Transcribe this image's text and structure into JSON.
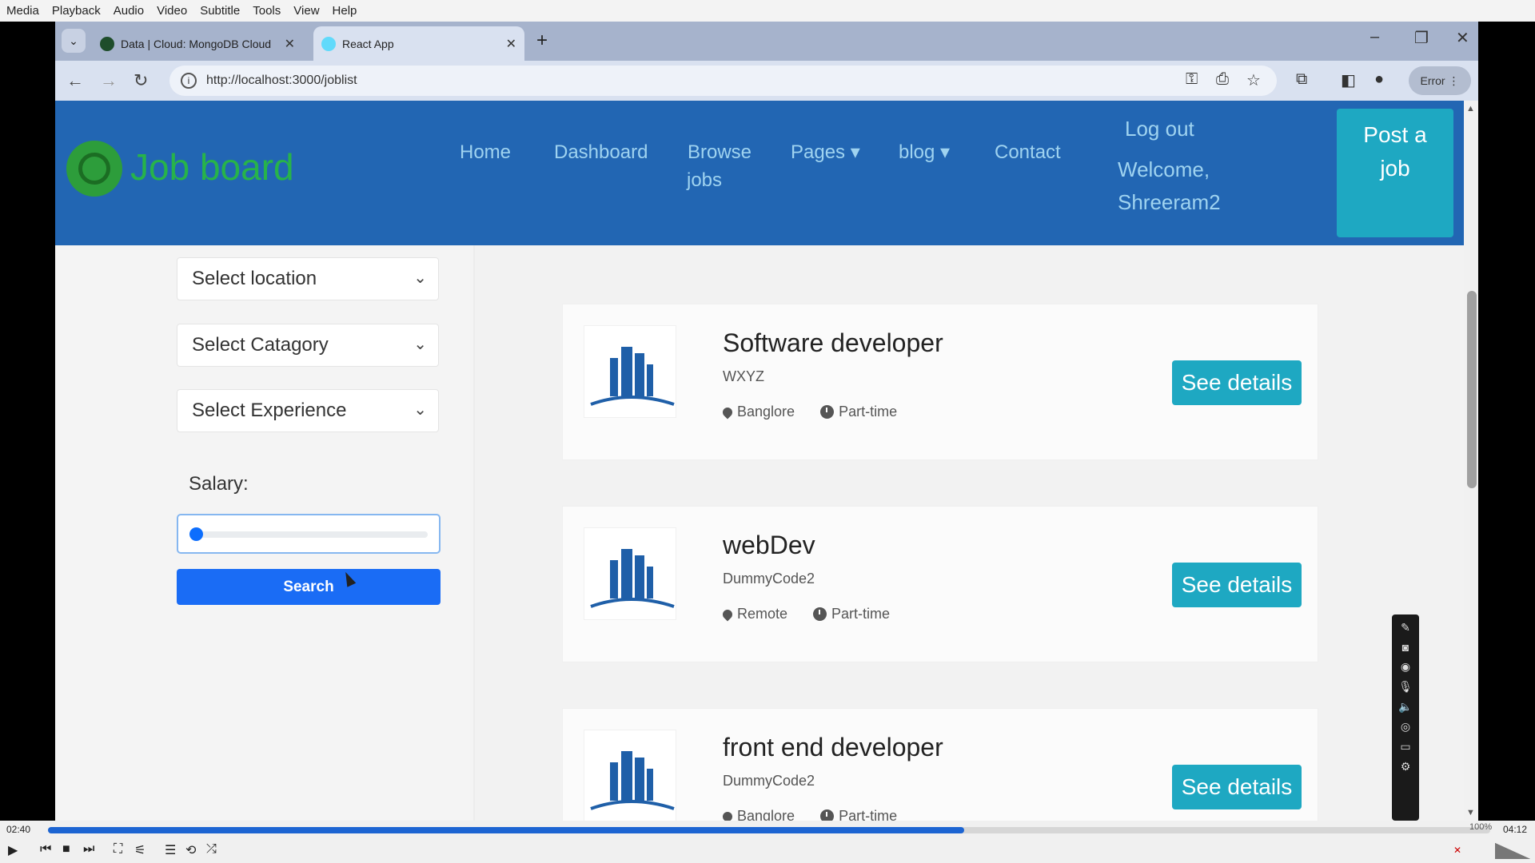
{
  "vlc": {
    "menu": [
      "Media",
      "Playback",
      "Audio",
      "Video",
      "Subtitle",
      "Tools",
      "View",
      "Help"
    ],
    "time_elapsed": "02:40",
    "time_total": "04:12",
    "progress": 0.635,
    "volume": "100%"
  },
  "browser": {
    "tabs": [
      {
        "title": "Data | Cloud: MongoDB Cloud",
        "favicon_color": "#1e4d2b"
      },
      {
        "title": "React App",
        "favicon_color": "#61dafb"
      }
    ],
    "url": "http://localhost:3000/joblist",
    "error_label": "Error"
  },
  "navbar": {
    "brand": "Job board",
    "links": {
      "home": "Home",
      "dashboard": "Dashboard",
      "browse_1": "Browse",
      "browse_2": "jobs",
      "pages": "Pages ▾",
      "blog": "blog ▾",
      "contact": "Contact"
    },
    "logout": "Log out",
    "welcome_1": "Welcome,",
    "welcome_2": "Shreeram2",
    "post_job_1": "Post a",
    "post_job_2": "job"
  },
  "filters": {
    "location": "Select location",
    "category": "Select Catagory",
    "experience": "Select Experience",
    "salary_label": "Salary:",
    "salary_value": 0,
    "search": "Search"
  },
  "jobs": [
    {
      "title": "Software developer",
      "company": "WXYZ",
      "location": "Banglore",
      "type": "Part-time",
      "button": "See details"
    },
    {
      "title": "webDev",
      "company": "DummyCode2",
      "location": "Remote",
      "type": "Part-time",
      "button": "See details"
    },
    {
      "title": "front end developer",
      "company": "DummyCode2",
      "location": "Banglore",
      "type": "Part-time",
      "button": "See details"
    }
  ],
  "colors": {
    "navbar": "#2266b3",
    "brand": "#27b34a",
    "accent": "#1ea8c2",
    "search": "#1a6cf5"
  }
}
